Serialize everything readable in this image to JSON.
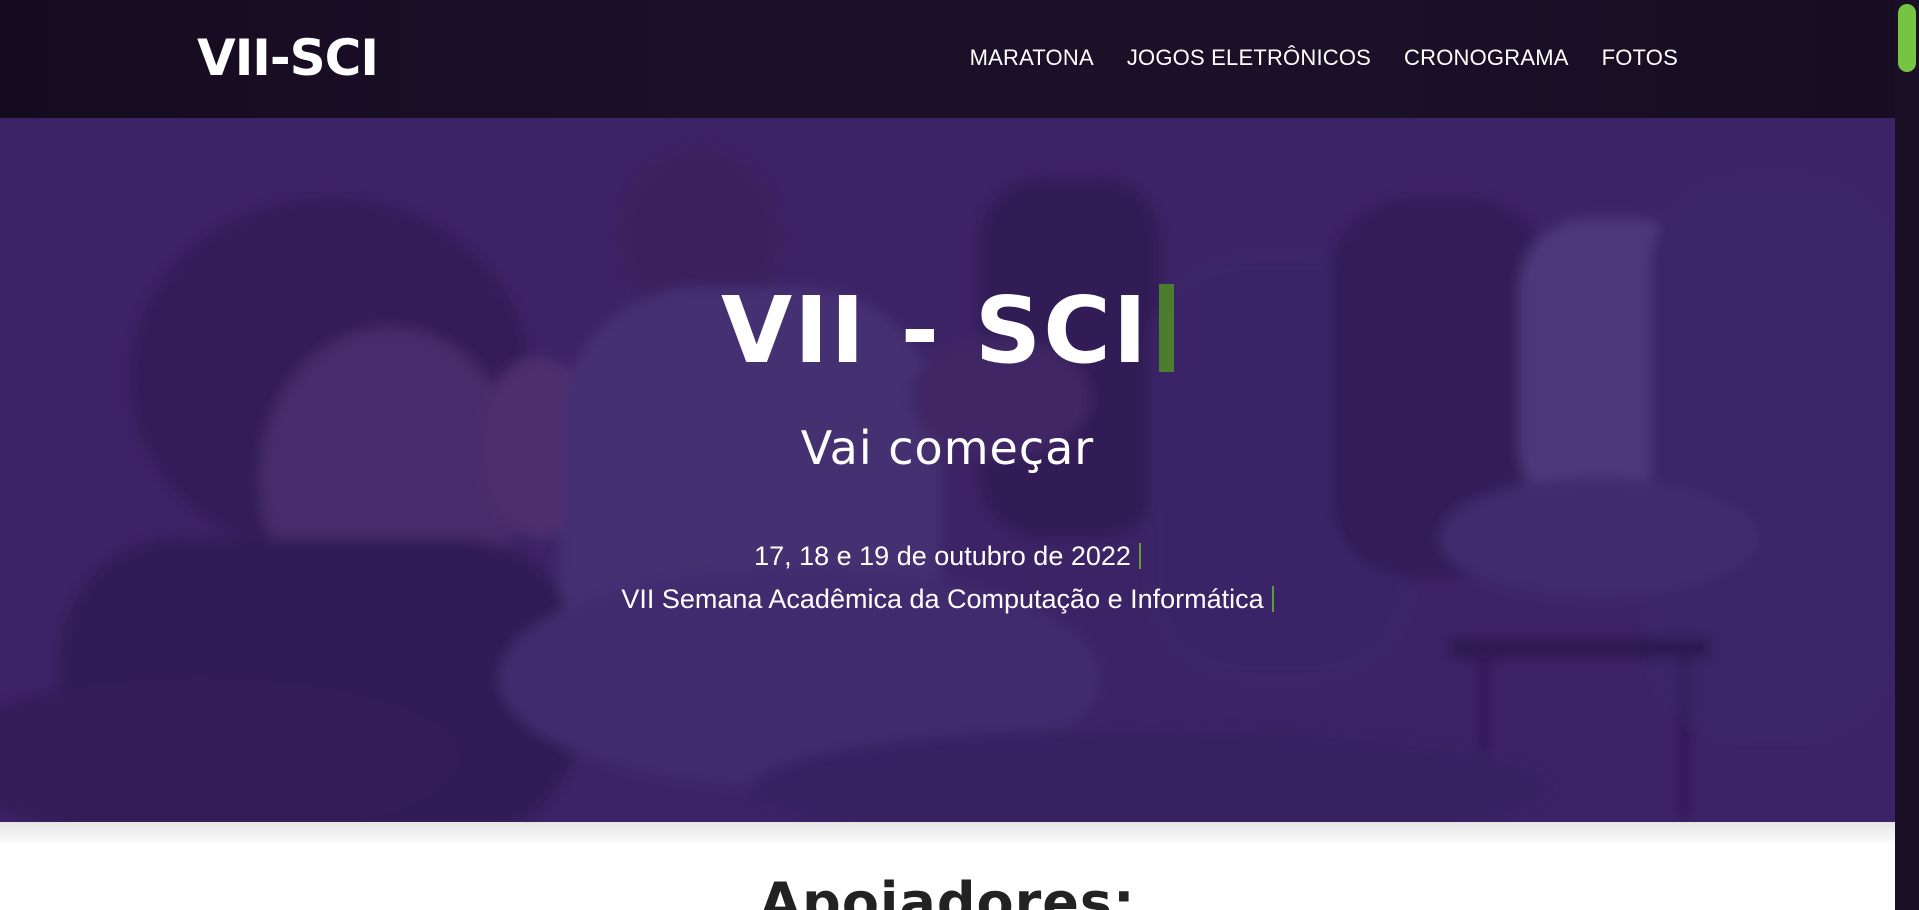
{
  "navbar": {
    "brand": "VII-SCI",
    "links": [
      {
        "label": "MARATONA"
      },
      {
        "label": "JOGOS ELETRÔNICOS"
      },
      {
        "label": "CRONOGRAMA"
      },
      {
        "label": "FOTOS"
      }
    ]
  },
  "hero": {
    "title": "VII - SCI",
    "subtitle": "Vai começar",
    "date_line": "17, 18 e 19 de outubro de 2022",
    "event_line": "VII Semana Acadêmica da Computação e Informática",
    "accent_color": "#5f9b3c"
  },
  "supporters": {
    "heading": "Apoiadores:"
  },
  "scrollbar": {
    "thumb_color": "#76c442"
  }
}
